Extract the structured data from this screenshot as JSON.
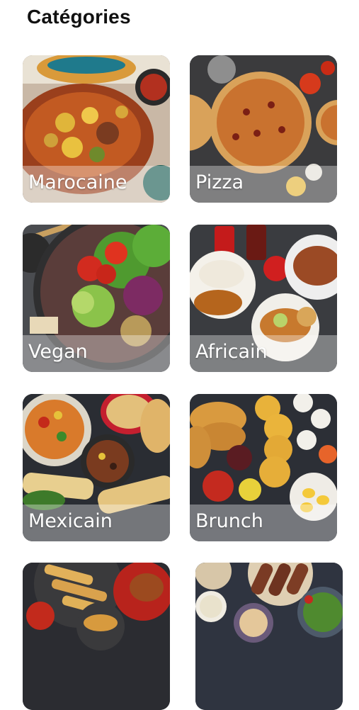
{
  "header": {
    "title": "Catégories"
  },
  "categories": [
    {
      "label": "Marocaine"
    },
    {
      "label": "Pizza"
    },
    {
      "label": "Vegan"
    },
    {
      "label": "Africain"
    },
    {
      "label": "Mexicain"
    },
    {
      "label": "Brunch"
    },
    {
      "label": ""
    },
    {
      "label": ""
    }
  ]
}
